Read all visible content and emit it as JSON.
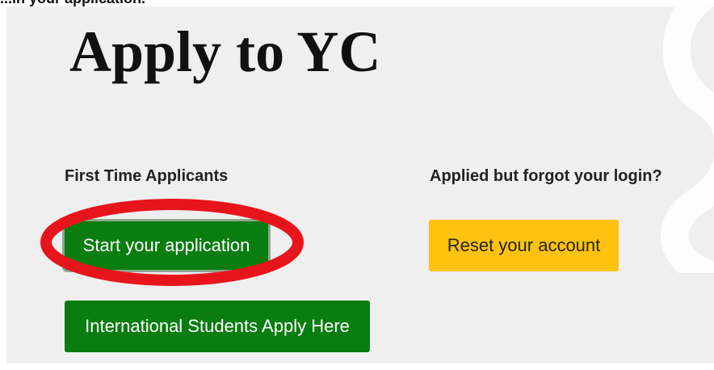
{
  "caption": "...in your application.",
  "page": {
    "title": "Apply to YC"
  },
  "first_time": {
    "heading": "First Time Applicants",
    "start_label": "Start your application",
    "international_label": "International Students Apply Here"
  },
  "forgot": {
    "heading": "Applied but forgot your login?",
    "reset_label": "Reset your account"
  },
  "annotation": {
    "type": "circle-highlight",
    "target": "start-application-button",
    "color": "#e8141c"
  },
  "colors": {
    "panel_background": "#efefef",
    "primary_button": "#0a7d10",
    "secondary_button": "#ffc20e",
    "highlight": "#e8141c"
  }
}
